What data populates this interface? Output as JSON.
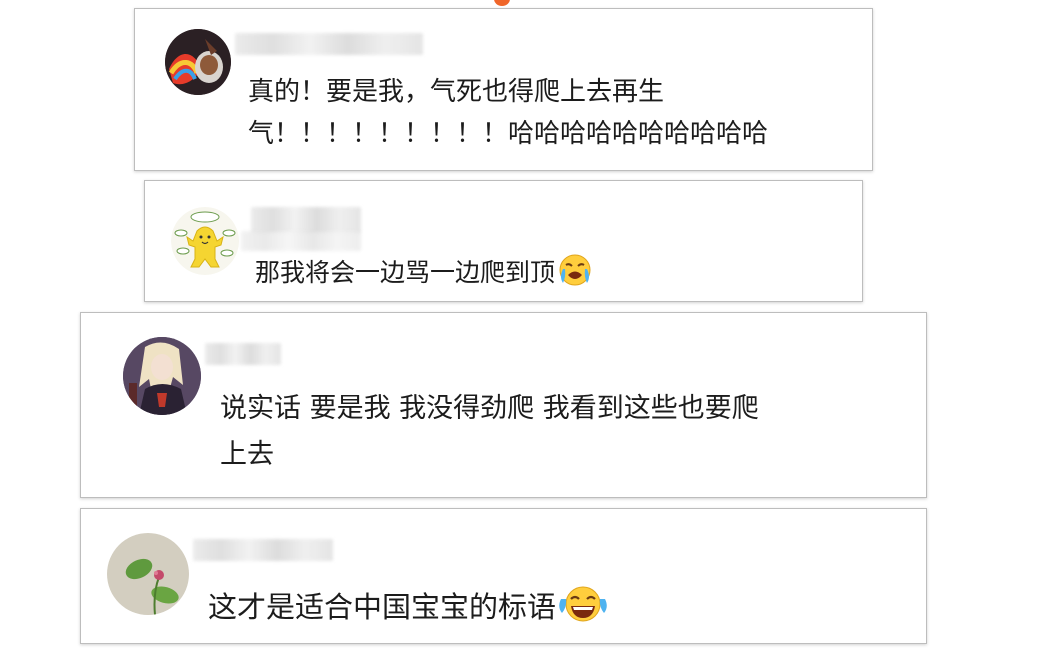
{
  "comments": [
    {
      "text_line1": "真的！要是我，气死也得爬上去再生",
      "text_line2": "气！！！！！！！！！哈哈哈哈哈哈哈哈哈哈"
    },
    {
      "text_line1": "那我将会一边骂一边爬到顶",
      "emoji": "crying-face-emoji"
    },
    {
      "text_line1": "说实话 要是我 我没得劲爬 我看到这些也要爬",
      "text_line2": "上去"
    },
    {
      "text_line1": "这才是适合中国宝宝的标语",
      "emoji": "laughing-tears-emoji"
    }
  ],
  "colors": {
    "accent_dot": "#f0662a",
    "card_border": "#bdbdbd",
    "text": "#1c1c1c"
  }
}
